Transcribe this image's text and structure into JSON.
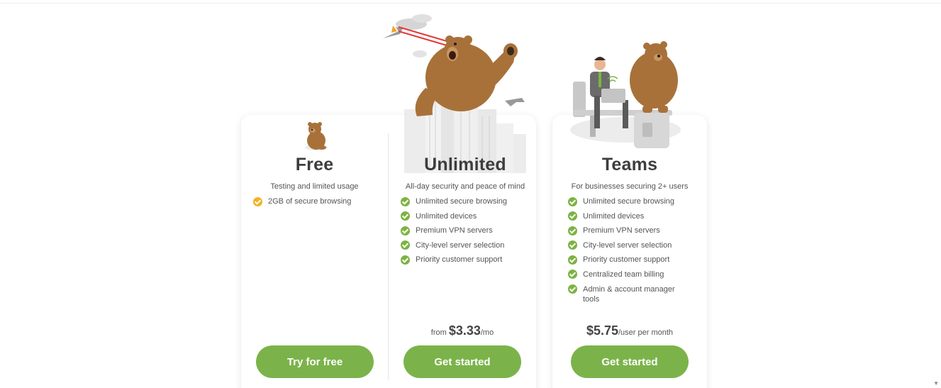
{
  "plans": [
    {
      "title": "Free",
      "subtitle": "Testing and limited usage",
      "features": [
        "2GB of secure browsing"
      ],
      "button": "Try for free"
    },
    {
      "title": "Unlimited",
      "subtitle": "All-day security and peace of mind",
      "features": [
        "Unlimited secure browsing",
        "Unlimited devices",
        "Premium VPN servers",
        "City-level server selection",
        "Priority customer support"
      ],
      "price_prefix": "from ",
      "price_amount": "$3.33",
      "price_suffix": "/mo",
      "button": "Get started"
    },
    {
      "title": "Teams",
      "subtitle": "For businesses securing 2+ users",
      "features": [
        "Unlimited secure browsing",
        "Unlimited devices",
        "Premium VPN servers",
        "City-level server selection",
        "Priority customer support",
        "Centralized team billing",
        "Admin & account manager tools"
      ],
      "price_amount": "$5.75",
      "price_suffix": "/user per month",
      "button": "Get started"
    }
  ],
  "colors": {
    "accent_green": "#7bb34a",
    "check_gold": "#f0b322",
    "bear_brown": "#a8713a"
  },
  "icons": {
    "feature_check": "check-circle-icon",
    "free_check": "check-circle-gold-icon"
  },
  "corner_mark": "▼"
}
